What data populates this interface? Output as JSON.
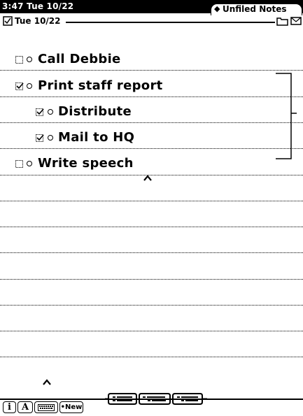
{
  "status_bar": {
    "time_date": "3:47 Tue 10/22",
    "folder_tab": "Unfiled Notes"
  },
  "header": {
    "date": "Tue 10/22"
  },
  "checklist": {
    "items": [
      {
        "text": "Call Debbie",
        "checked": false,
        "level": 0
      },
      {
        "text": "Print staff report",
        "checked": true,
        "level": 0
      },
      {
        "text": "Distribute",
        "checked": true,
        "level": 1
      },
      {
        "text": "Mail to HQ",
        "checked": true,
        "level": 1
      },
      {
        "text": "Write speech",
        "checked": false,
        "level": 0
      }
    ]
  },
  "toolbar": {
    "info_label": "i",
    "styles_label": "A",
    "keyboard_icon": "keyboard-icon",
    "new_label": "•New"
  },
  "icons": {
    "date_checkbox": "checklist-icon",
    "folder": "folder-icon",
    "routing": "envelope-icon",
    "outline_controls": [
      "outline-collapse-icon",
      "outline-indent-icon",
      "outline-expand-icon"
    ]
  }
}
